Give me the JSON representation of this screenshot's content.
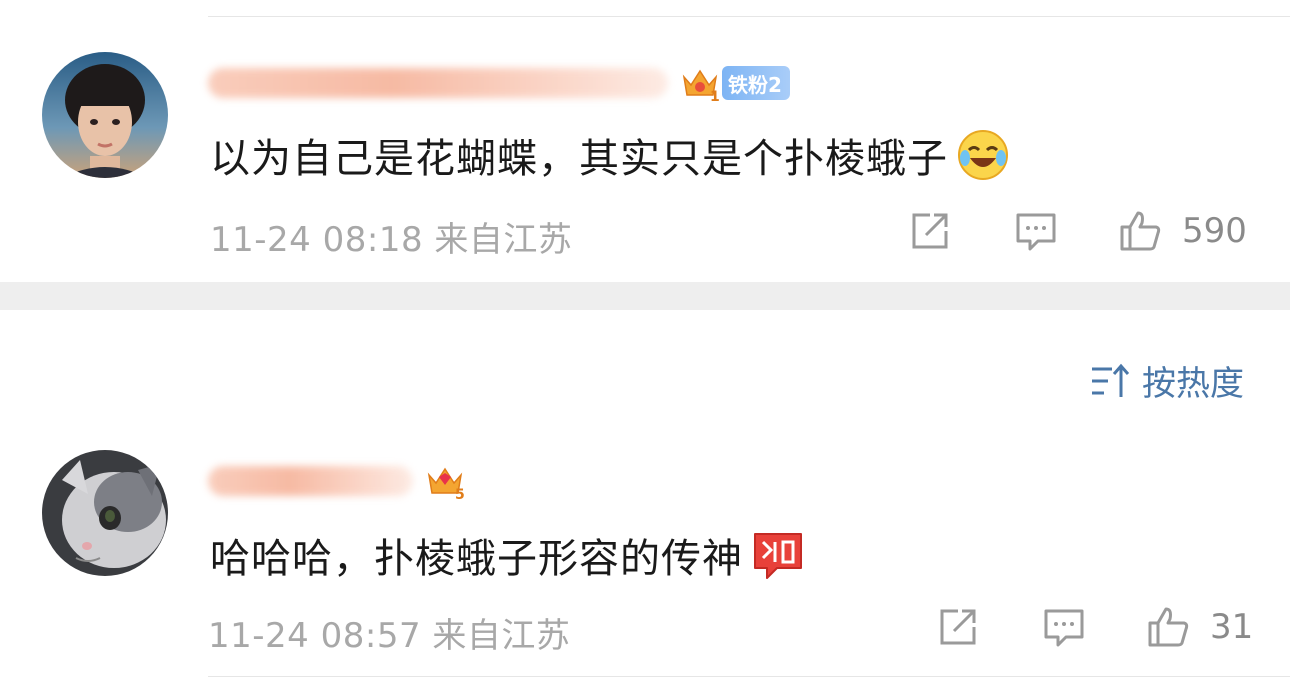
{
  "comments": [
    {
      "text": "以为自己是花蝴蝶，其实只是个扑棱蛾子",
      "fan_badge": "铁粉2",
      "crown_level": "1",
      "meta": "11-24 08:18 来自江苏",
      "likes": "590",
      "emoji": "laughing-crying-emoji"
    },
    {
      "text": "哈哈哈，扑棱蛾子形容的传神",
      "crown_level": "5",
      "meta": "11-24 08:57 来自江苏",
      "likes": "31",
      "emoji": "gei-li-sticker"
    }
  ],
  "sort": {
    "label": "按热度"
  },
  "colors": {
    "link_blue": "#4a77a8",
    "meta_gray": "#a8a8a8",
    "fan_badge_blue": "#7db4f4",
    "sticker_red": "#e8413a"
  }
}
